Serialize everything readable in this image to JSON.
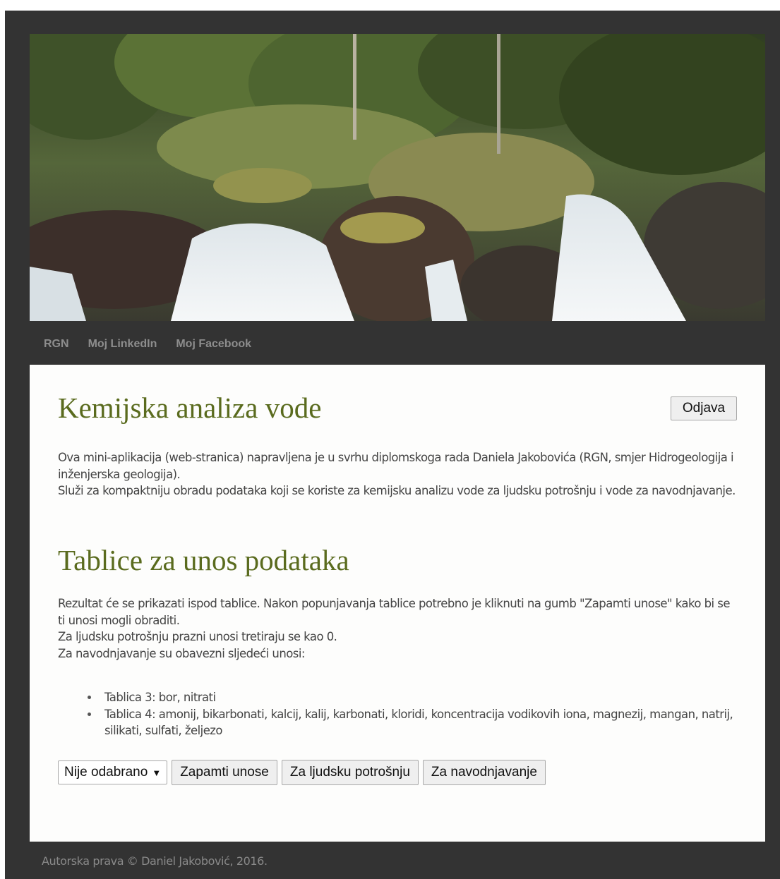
{
  "nav": {
    "items": [
      {
        "label": "RGN"
      },
      {
        "label": "Moj LinkedIn"
      },
      {
        "label": "Moj Facebook"
      }
    ]
  },
  "header": {
    "title": "Kemijska analiza vode",
    "logout_label": "Odjava"
  },
  "intro": {
    "line1": "Ova mini-aplikacija (web-stranica) napravljena je u svrhu diplomskoga rada Daniela Jakobovića (RGN, smjer Hidrogeologija i inženjerska geologija).",
    "line2": "Služi za kompaktniju obradu podataka koji se koriste za kemijsku analizu vode za ljudsku potrošnju i vode za navodnjavanje."
  },
  "section": {
    "title": "Tablice za unos podataka",
    "line1": "Rezultat će se prikazati ispod tablice. Nakon popunjavanja tablice potrebno je kliknuti na gumb \"Zapamti unose\" kako bi se ti unosi mogli obraditi.",
    "line2": "Za ljudsku potrošnju prazni unosi tretiraju se kao 0.",
    "line3": "Za navodnjavanje su obavezni sljedeći unosi:",
    "requirements": [
      "Tablica 3: bor, nitrati",
      "Tablica 4: amonij, bikarbonati, kalcij, kalij, karbonati, kloridi, koncentracija vodikovih iona, magnezij, mangan, natrij, silikati, sulfati, željezo"
    ]
  },
  "controls": {
    "select_value": "Nije odabrano",
    "save_label": "Zapamti unose",
    "human_label": "Za ljudsku potrošnju",
    "irrigation_label": "Za navodnjavanje"
  },
  "footer": {
    "text": "Autorska prava © Daniel Jakobović, 2016."
  },
  "colors": {
    "frame": "#333333",
    "panel": "#fdfdfc",
    "heading": "#5a6b1e",
    "nav_text": "#8d8d8d",
    "body_text": "#444444"
  }
}
